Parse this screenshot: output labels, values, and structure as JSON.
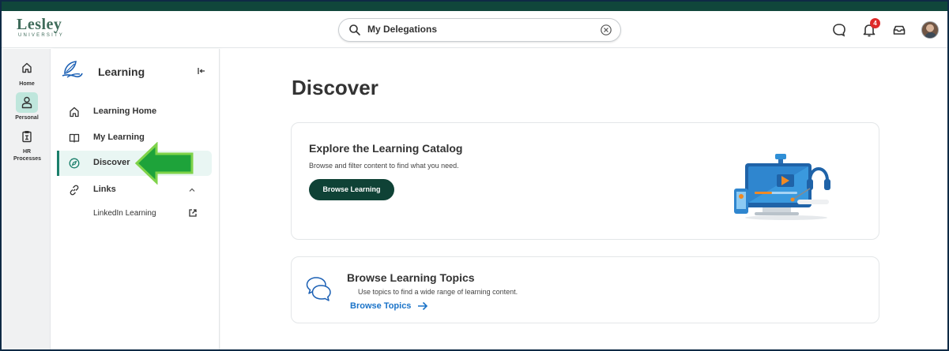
{
  "header": {
    "logo_main": "Lesley",
    "logo_sub": "UNIVERSITY",
    "search_value": "My Delegations",
    "notification_count": "4",
    "icons": [
      "search-icon",
      "clear-icon",
      "chat-icon",
      "bell-icon",
      "inbox-icon",
      "avatar"
    ]
  },
  "rail": {
    "items": [
      {
        "label": "Home",
        "icon": "home-icon"
      },
      {
        "label": "Personal",
        "icon": "person-icon",
        "active": true
      },
      {
        "label": "HR Processes",
        "icon": "clipboard-icon"
      }
    ]
  },
  "panel": {
    "title": "Learning",
    "nav": [
      {
        "label": "Learning Home",
        "icon": "home-icon"
      },
      {
        "label": "My Learning",
        "icon": "book-icon"
      },
      {
        "label": "Discover",
        "icon": "compass-icon",
        "active": true
      },
      {
        "label": "Links",
        "icon": "link-icon"
      }
    ],
    "sub_links": [
      {
        "label": "LinkedIn Learning",
        "icon": "external-link-icon"
      }
    ]
  },
  "main": {
    "title": "Discover",
    "catalog": {
      "title": "Explore the Learning Catalog",
      "description": "Browse and filter content to find what you need.",
      "button": "Browse Learning"
    },
    "topics": {
      "title": "Browse Learning Topics",
      "description": "Use topics to find a wide range of learning content.",
      "link": "Browse Topics"
    }
  },
  "colors": {
    "brand_dark": "#10463b",
    "accent_teal": "#1b7f6b",
    "link_blue": "#1a73c8",
    "badge_red": "#de2b2b",
    "callout_green": "#1ea33a"
  }
}
